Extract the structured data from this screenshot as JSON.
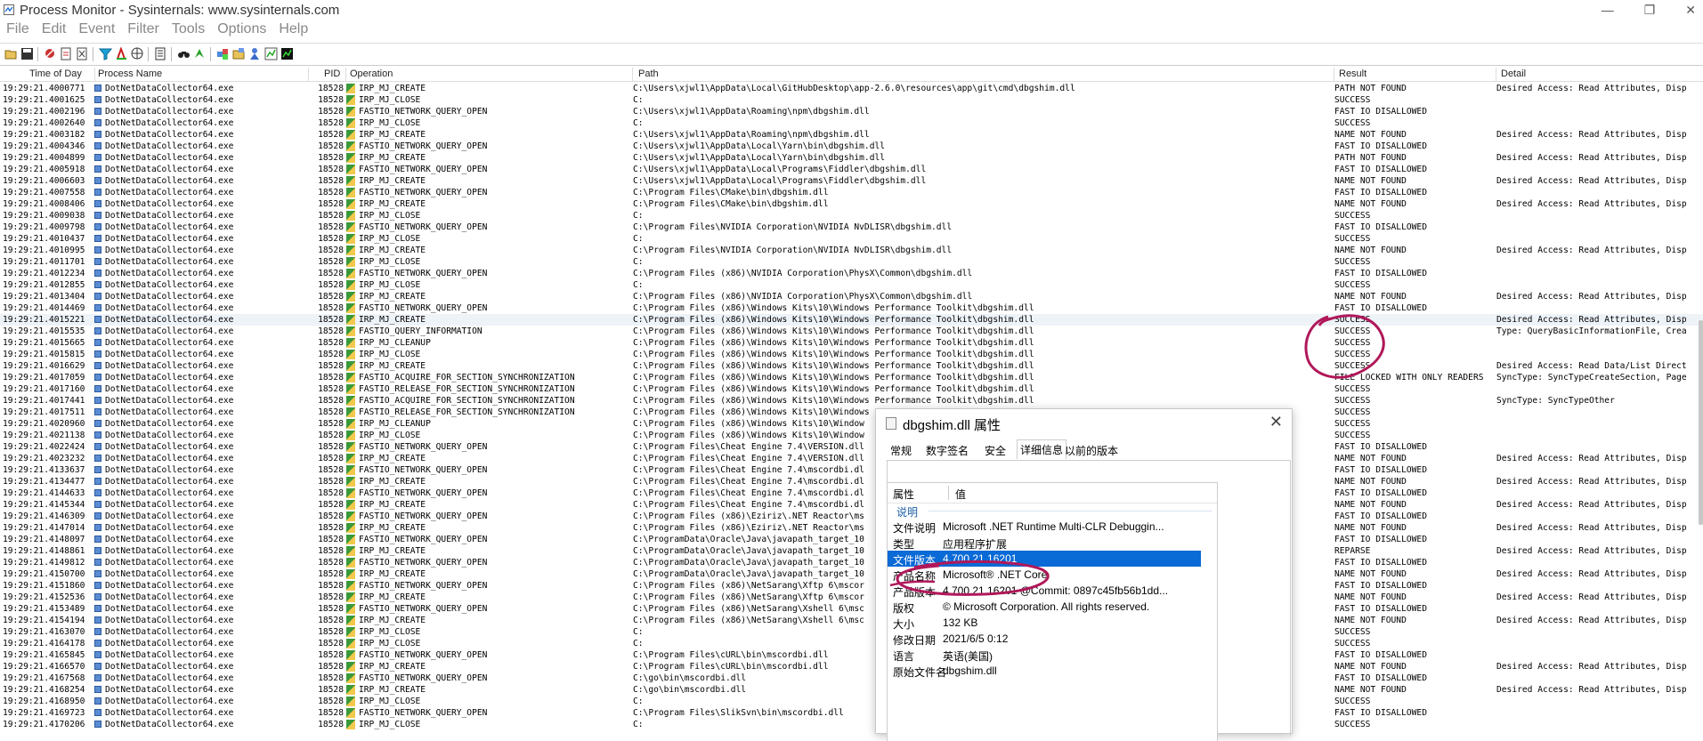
{
  "window": {
    "title": "Process Monitor - Sysinternals: www.sysinternals.com"
  },
  "window_controls": {
    "minimize": "—",
    "maximize": "❐",
    "close": "✕"
  },
  "menu": [
    "File",
    "Edit",
    "Event",
    "Filter",
    "Tools",
    "Options",
    "Help"
  ],
  "toolbar_icons": [
    "open-icon",
    "save-icon",
    "capture-icon",
    "autoscroll-icon",
    "clear-icon",
    "filter-icon",
    "highlight-icon",
    "include-process-icon",
    "network-icon",
    "properties-icon",
    "find-icon",
    "jump-icon",
    "registry-icon",
    "file-system-icon",
    "process-icon",
    "thread-icon",
    "profiling-icon"
  ],
  "columns": {
    "time": "Time of Day",
    "process": "Process Name",
    "pid": "PID",
    "operation": "Operation",
    "path": "Path",
    "result": "Result",
    "detail": "Detail"
  },
  "rows": [
    [
      "19:29:21.4000771",
      "DotNetDataCollector64.exe",
      "18528",
      "IRP_MJ_CREATE",
      "C:\\Users\\xjwl1\\AppData\\Local\\GitHubDesktop\\app-2.6.0\\resources\\app\\git\\cmd\\dbgshim.dll",
      "PATH NOT FOUND",
      "Desired Access: Read Attributes, Disp"
    ],
    [
      "19:29:21.4001625",
      "DotNetDataCollector64.exe",
      "18528",
      "IRP_MJ_CLOSE",
      "C:",
      "SUCCESS",
      ""
    ],
    [
      "19:29:21.4002196",
      "DotNetDataCollector64.exe",
      "18528",
      "FASTIO_NETWORK_QUERY_OPEN",
      "C:\\Users\\xjwl1\\AppData\\Roaming\\npm\\dbgshim.dll",
      "FAST IO DISALLOWED",
      ""
    ],
    [
      "19:29:21.4002640",
      "DotNetDataCollector64.exe",
      "18528",
      "IRP_MJ_CLOSE",
      "C:",
      "SUCCESS",
      ""
    ],
    [
      "19:29:21.4003182",
      "DotNetDataCollector64.exe",
      "18528",
      "IRP_MJ_CREATE",
      "C:\\Users\\xjwl1\\AppData\\Roaming\\npm\\dbgshim.dll",
      "NAME NOT FOUND",
      "Desired Access: Read Attributes, Disp"
    ],
    [
      "19:29:21.4004346",
      "DotNetDataCollector64.exe",
      "18528",
      "FASTIO_NETWORK_QUERY_OPEN",
      "C:\\Users\\xjwl1\\AppData\\Local\\Yarn\\bin\\dbgshim.dll",
      "FAST IO DISALLOWED",
      ""
    ],
    [
      "19:29:21.4004899",
      "DotNetDataCollector64.exe",
      "18528",
      "IRP_MJ_CREATE",
      "C:\\Users\\xjwl1\\AppData\\Local\\Yarn\\bin\\dbgshim.dll",
      "PATH NOT FOUND",
      "Desired Access: Read Attributes, Disp"
    ],
    [
      "19:29:21.4005918",
      "DotNetDataCollector64.exe",
      "18528",
      "FASTIO_NETWORK_QUERY_OPEN",
      "C:\\Users\\xjwl1\\AppData\\Local\\Programs\\Fiddler\\dbgshim.dll",
      "FAST IO DISALLOWED",
      ""
    ],
    [
      "19:29:21.4006603",
      "DotNetDataCollector64.exe",
      "18528",
      "IRP_MJ_CREATE",
      "C:\\Users\\xjwl1\\AppData\\Local\\Programs\\Fiddler\\dbgshim.dll",
      "NAME NOT FOUND",
      "Desired Access: Read Attributes, Disp"
    ],
    [
      "19:29:21.4007558",
      "DotNetDataCollector64.exe",
      "18528",
      "FASTIO_NETWORK_QUERY_OPEN",
      "C:\\Program Files\\CMake\\bin\\dbgshim.dll",
      "FAST IO DISALLOWED",
      ""
    ],
    [
      "19:29:21.4008406",
      "DotNetDataCollector64.exe",
      "18528",
      "IRP_MJ_CREATE",
      "C:\\Program Files\\CMake\\bin\\dbgshim.dll",
      "NAME NOT FOUND",
      "Desired Access: Read Attributes, Disp"
    ],
    [
      "19:29:21.4009038",
      "DotNetDataCollector64.exe",
      "18528",
      "IRP_MJ_CLOSE",
      "C:",
      "SUCCESS",
      ""
    ],
    [
      "19:29:21.4009798",
      "DotNetDataCollector64.exe",
      "18528",
      "FASTIO_NETWORK_QUERY_OPEN",
      "C:\\Program Files\\NVIDIA Corporation\\NVIDIA NvDLISR\\dbgshim.dll",
      "FAST IO DISALLOWED",
      ""
    ],
    [
      "19:29:21.4010437",
      "DotNetDataCollector64.exe",
      "18528",
      "IRP_MJ_CLOSE",
      "C:",
      "SUCCESS",
      ""
    ],
    [
      "19:29:21.4010995",
      "DotNetDataCollector64.exe",
      "18528",
      "IRP_MJ_CREATE",
      "C:\\Program Files\\NVIDIA Corporation\\NVIDIA NvDLISR\\dbgshim.dll",
      "NAME NOT FOUND",
      "Desired Access: Read Attributes, Disp"
    ],
    [
      "19:29:21.4011701",
      "DotNetDataCollector64.exe",
      "18528",
      "IRP_MJ_CLOSE",
      "C:",
      "SUCCESS",
      ""
    ],
    [
      "19:29:21.4012234",
      "DotNetDataCollector64.exe",
      "18528",
      "FASTIO_NETWORK_QUERY_OPEN",
      "C:\\Program Files (x86)\\NVIDIA Corporation\\PhysX\\Common\\dbgshim.dll",
      "FAST IO DISALLOWED",
      ""
    ],
    [
      "19:29:21.4012855",
      "DotNetDataCollector64.exe",
      "18528",
      "IRP_MJ_CLOSE",
      "C:",
      "SUCCESS",
      ""
    ],
    [
      "19:29:21.4013404",
      "DotNetDataCollector64.exe",
      "18528",
      "IRP_MJ_CREATE",
      "C:\\Program Files (x86)\\NVIDIA Corporation\\PhysX\\Common\\dbgshim.dll",
      "NAME NOT FOUND",
      "Desired Access: Read Attributes, Disp"
    ],
    [
      "19:29:21.4014469",
      "DotNetDataCollector64.exe",
      "18528",
      "FASTIO_NETWORK_QUERY_OPEN",
      "C:\\Program Files (x86)\\Windows Kits\\10\\Windows Performance Toolkit\\dbgshim.dll",
      "FAST IO DISALLOWED",
      ""
    ],
    [
      "19:29:21.4015221",
      "DotNetDataCollector64.exe",
      "18528",
      "IRP_MJ_CREATE",
      "C:\\Program Files (x86)\\Windows Kits\\10\\Windows Performance Toolkit\\dbgshim.dll",
      "SUCCESS",
      "Desired Access: Read Attributes, Disp"
    ],
    [
      "19:29:21.4015535",
      "DotNetDataCollector64.exe",
      "18528",
      "FASTIO_QUERY_INFORMATION",
      "C:\\Program Files (x86)\\Windows Kits\\10\\Windows Performance Toolkit\\dbgshim.dll",
      "SUCCESS",
      "Type: QueryBasicInformationFile, Crea"
    ],
    [
      "19:29:21.4015665",
      "DotNetDataCollector64.exe",
      "18528",
      "IRP_MJ_CLEANUP",
      "C:\\Program Files (x86)\\Windows Kits\\10\\Windows Performance Toolkit\\dbgshim.dll",
      "SUCCESS",
      ""
    ],
    [
      "19:29:21.4015815",
      "DotNetDataCollector64.exe",
      "18528",
      "IRP_MJ_CLOSE",
      "C:\\Program Files (x86)\\Windows Kits\\10\\Windows Performance Toolkit\\dbgshim.dll",
      "SUCCESS",
      ""
    ],
    [
      "19:29:21.4016629",
      "DotNetDataCollector64.exe",
      "18528",
      "IRP_MJ_CREATE",
      "C:\\Program Files (x86)\\Windows Kits\\10\\Windows Performance Toolkit\\dbgshim.dll",
      "SUCCESS",
      "Desired Access: Read Data/List Direct"
    ],
    [
      "19:29:21.4017059",
      "DotNetDataCollector64.exe",
      "18528",
      "FASTIO_ACQUIRE_FOR_SECTION_SYNCHRONIZATION",
      "C:\\Program Files (x86)\\Windows Kits\\10\\Windows Performance Toolkit\\dbgshim.dll",
      "FILE LOCKED WITH ONLY READERS",
      "SyncType: SyncTypeCreateSection, Page"
    ],
    [
      "19:29:21.4017160",
      "DotNetDataCollector64.exe",
      "18528",
      "FASTIO_RELEASE_FOR_SECTION_SYNCHRONIZATION",
      "C:\\Program Files (x86)\\Windows Kits\\10\\Windows Performance Toolkit\\dbgshim.dll",
      "SUCCESS",
      ""
    ],
    [
      "19:29:21.4017441",
      "DotNetDataCollector64.exe",
      "18528",
      "FASTIO_ACQUIRE_FOR_SECTION_SYNCHRONIZATION",
      "C:\\Program Files (x86)\\Windows Kits\\10\\Windows Performance Toolkit\\dbgshim.dll",
      "SUCCESS",
      "SyncType: SyncTypeOther"
    ],
    [
      "19:29:21.4017511",
      "DotNetDataCollector64.exe",
      "18528",
      "FASTIO_RELEASE_FOR_SECTION_SYNCHRONIZATION",
      "C:\\Program Files (x86)\\Windows Kits\\10\\Windows",
      "SUCCESS",
      ""
    ],
    [
      "19:29:21.4020960",
      "DotNetDataCollector64.exe",
      "18528",
      "IRP_MJ_CLEANUP",
      "C:\\Program Files (x86)\\Windows Kits\\10\\Window",
      "SUCCESS",
      ""
    ],
    [
      "19:29:21.4021138",
      "DotNetDataCollector64.exe",
      "18528",
      "IRP_MJ_CLOSE",
      "C:\\Program Files (x86)\\Windows Kits\\10\\Window",
      "SUCCESS",
      ""
    ],
    [
      "19:29:21.4022424",
      "DotNetDataCollector64.exe",
      "18528",
      "FASTIO_NETWORK_QUERY_OPEN",
      "C:\\Program Files\\Cheat Engine 7.4\\VERSION.dll",
      "FAST IO DISALLOWED",
      ""
    ],
    [
      "19:29:21.4023232",
      "DotNetDataCollector64.exe",
      "18528",
      "IRP_MJ_CREATE",
      "C:\\Program Files\\Cheat Engine 7.4\\VERSION.dll",
      "NAME NOT FOUND",
      "Desired Access: Read Attributes, Disp"
    ],
    [
      "19:29:21.4133637",
      "DotNetDataCollector64.exe",
      "18528",
      "FASTIO_NETWORK_QUERY_OPEN",
      "C:\\Program Files\\Cheat Engine 7.4\\mscordbi.dl",
      "FAST IO DISALLOWED",
      ""
    ],
    [
      "19:29:21.4134477",
      "DotNetDataCollector64.exe",
      "18528",
      "IRP_MJ_CREATE",
      "C:\\Program Files\\Cheat Engine 7.4\\mscordbi.dl",
      "NAME NOT FOUND",
      "Desired Access: Read Attributes, Disp"
    ],
    [
      "19:29:21.4144633",
      "DotNetDataCollector64.exe",
      "18528",
      "FASTIO_NETWORK_QUERY_OPEN",
      "C:\\Program Files\\Cheat Engine 7.4\\mscordbi.dl",
      "FAST IO DISALLOWED",
      ""
    ],
    [
      "19:29:21.4145344",
      "DotNetDataCollector64.exe",
      "18528",
      "IRP_MJ_CREATE",
      "C:\\Program Files\\Cheat Engine 7.4\\mscordbi.dl",
      "NAME NOT FOUND",
      "Desired Access: Read Attributes, Disp"
    ],
    [
      "19:29:21.4146309",
      "DotNetDataCollector64.exe",
      "18528",
      "FASTIO_NETWORK_QUERY_OPEN",
      "C:\\Program Files (x86)\\Eziriz\\.NET Reactor\\ms",
      "FAST IO DISALLOWED",
      ""
    ],
    [
      "19:29:21.4147014",
      "DotNetDataCollector64.exe",
      "18528",
      "IRP_MJ_CREATE",
      "C:\\Program Files (x86)\\Eziriz\\.NET Reactor\\ms",
      "NAME NOT FOUND",
      "Desired Access: Read Attributes, Disp"
    ],
    [
      "19:29:21.4148097",
      "DotNetDataCollector64.exe",
      "18528",
      "FASTIO_NETWORK_QUERY_OPEN",
      "C:\\ProgramData\\Oracle\\Java\\javapath_target_10",
      "FAST IO DISALLOWED",
      ""
    ],
    [
      "19:29:21.4148861",
      "DotNetDataCollector64.exe",
      "18528",
      "IRP_MJ_CREATE",
      "C:\\ProgramData\\Oracle\\Java\\javapath_target_10",
      "REPARSE",
      "Desired Access: Read Attributes, Disp"
    ],
    [
      "19:29:21.4149812",
      "DotNetDataCollector64.exe",
      "18528",
      "FASTIO_NETWORK_QUERY_OPEN",
      "C:\\ProgramData\\Oracle\\Java\\javapath_target_10",
      "FAST IO DISALLOWED",
      ""
    ],
    [
      "19:29:21.4150700",
      "DotNetDataCollector64.exe",
      "18528",
      "IRP_MJ_CREATE",
      "C:\\ProgramData\\Oracle\\Java\\javapath_target_10",
      "NAME NOT FOUND",
      "Desired Access: Read Attributes, Disp"
    ],
    [
      "19:29:21.4151860",
      "DotNetDataCollector64.exe",
      "18528",
      "FASTIO_NETWORK_QUERY_OPEN",
      "C:\\Program Files (x86)\\NetSarang\\Xftp 6\\mscor",
      "FAST IO DISALLOWED",
      ""
    ],
    [
      "19:29:21.4152536",
      "DotNetDataCollector64.exe",
      "18528",
      "IRP_MJ_CREATE",
      "C:\\Program Files (x86)\\NetSarang\\Xftp 6\\mscor",
      "NAME NOT FOUND",
      "Desired Access: Read Attributes, Disp"
    ],
    [
      "19:29:21.4153489",
      "DotNetDataCollector64.exe",
      "18528",
      "FASTIO_NETWORK_QUERY_OPEN",
      "C:\\Program Files (x86)\\NetSarang\\Xshell 6\\msc",
      "FAST IO DISALLOWED",
      ""
    ],
    [
      "19:29:21.4154194",
      "DotNetDataCollector64.exe",
      "18528",
      "IRP_MJ_CREATE",
      "C:\\Program Files (x86)\\NetSarang\\Xshell 6\\msc",
      "NAME NOT FOUND",
      "Desired Access: Read Attributes, Disp"
    ],
    [
      "19:29:21.4163070",
      "DotNetDataCollector64.exe",
      "18528",
      "IRP_MJ_CLOSE",
      "C:",
      "SUCCESS",
      ""
    ],
    [
      "19:29:21.4164178",
      "DotNetDataCollector64.exe",
      "18528",
      "IRP_MJ_CLOSE",
      "C:",
      "SUCCESS",
      ""
    ],
    [
      "19:29:21.4165845",
      "DotNetDataCollector64.exe",
      "18528",
      "FASTIO_NETWORK_QUERY_OPEN",
      "C:\\Program Files\\cURL\\bin\\mscordbi.dll",
      "FAST IO DISALLOWED",
      ""
    ],
    [
      "19:29:21.4166570",
      "DotNetDataCollector64.exe",
      "18528",
      "IRP_MJ_CREATE",
      "C:\\Program Files\\cURL\\bin\\mscordbi.dll",
      "NAME NOT FOUND",
      "Desired Access: Read Attributes, Disp"
    ],
    [
      "19:29:21.4167568",
      "DotNetDataCollector64.exe",
      "18528",
      "FASTIO_NETWORK_QUERY_OPEN",
      "C:\\go\\bin\\mscordbi.dll",
      "FAST IO DISALLOWED",
      ""
    ],
    [
      "19:29:21.4168254",
      "DotNetDataCollector64.exe",
      "18528",
      "IRP_MJ_CREATE",
      "C:\\go\\bin\\mscordbi.dll",
      "NAME NOT FOUND",
      "Desired Access: Read Attributes, Disp"
    ],
    [
      "19:29:21.4168950",
      "DotNetDataCollector64.exe",
      "18528",
      "IRP_MJ_CLOSE",
      "C:",
      "SUCCESS",
      ""
    ],
    [
      "19:29:21.4169723",
      "DotNetDataCollector64.exe",
      "18528",
      "FASTIO_NETWORK_QUERY_OPEN",
      "C:\\Program Files\\SlikSvn\\bin\\mscordbi.dll",
      "FAST IO DISALLOWED",
      ""
    ],
    [
      "19:29:21.4170206",
      "DotNetDataCollector64.exe",
      "18528",
      "IRP_MJ_CLOSE",
      "C:",
      "SUCCESS",
      ""
    ]
  ],
  "highlighted_row_index": 20,
  "dialog": {
    "title": "dbgshim.dll 属性",
    "close": "✕",
    "tabs": [
      "常规",
      "数字签名",
      "安全",
      "详细信息",
      "以前的版本"
    ],
    "active_tab": "详细信息",
    "header_property": "属性",
    "header_value": "值",
    "group": "说明",
    "properties": [
      {
        "key": "文件说明",
        "value": "Microsoft .NET Runtime Multi-CLR Debuggin..."
      },
      {
        "key": "类型",
        "value": "应用程序扩展"
      },
      {
        "key": "文件版本",
        "value": "4.700.21.16201"
      },
      {
        "key": "产品名称",
        "value": "Microsoft® .NET Core"
      },
      {
        "key": "产品版本",
        "value": "4,700,21,16201 @Commit: 0897c45fb56b1dd..."
      },
      {
        "key": "版权",
        "value": "© Microsoft Corporation.  All rights reserved."
      },
      {
        "key": "大小",
        "value": "132 KB"
      },
      {
        "key": "修改日期",
        "value": "2021/6/5 0:12"
      },
      {
        "key": "语言",
        "value": "英语(美国)"
      },
      {
        "key": "原始文件名",
        "value": "dbgshim.dll"
      }
    ],
    "selected_property_index": 2
  },
  "annotation_color": "#b0185a"
}
